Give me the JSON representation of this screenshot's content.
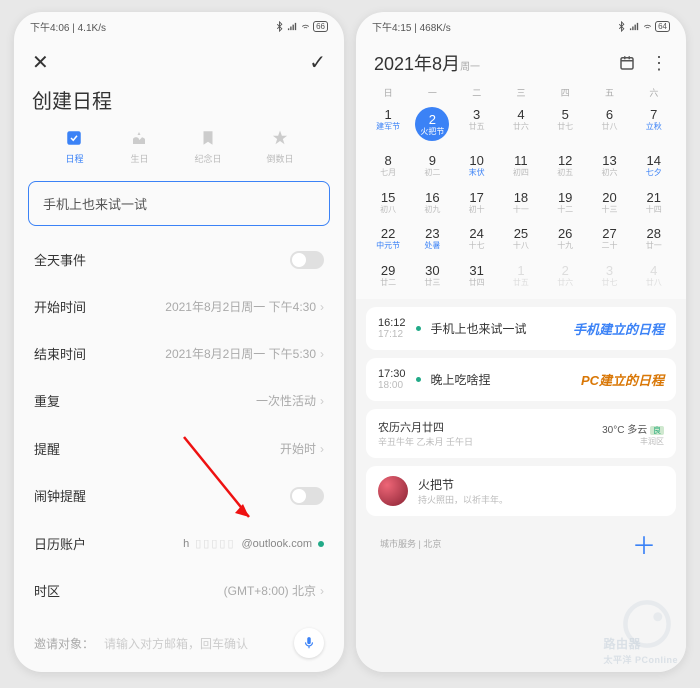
{
  "left": {
    "status": {
      "time": "下午4:06",
      "net": "4.1K/s",
      "battery": "66"
    },
    "title": "创建日程",
    "tabs": [
      {
        "label": "日程",
        "icon": "check-box"
      },
      {
        "label": "生日",
        "icon": "cake"
      },
      {
        "label": "纪念日",
        "icon": "bookmark"
      },
      {
        "label": "倒数日",
        "icon": "star"
      }
    ],
    "subject": "手机上也来试一试",
    "rows": {
      "allday": {
        "label": "全天事件"
      },
      "start": {
        "label": "开始时间",
        "value": "2021年8月2日周一 下午4:30"
      },
      "end": {
        "label": "结束时间",
        "value": "2021年8月2日周一 下午5:30"
      },
      "repeat": {
        "label": "重复",
        "value": "一次性活动"
      },
      "remind": {
        "label": "提醒",
        "value": "开始时"
      },
      "alarm": {
        "label": "闹钟提醒"
      },
      "account": {
        "label": "日历账户",
        "prefix": "h",
        "domain": "@outlook.com"
      },
      "tz": {
        "label": "时区",
        "value": "(GMT+8:00) 北京"
      }
    },
    "invite": {
      "label": "邀请对象：",
      "placeholder": "请输入对方邮箱，回车确认"
    }
  },
  "right": {
    "status": {
      "time": "下午4:15",
      "net": "468K/s",
      "battery": "64"
    },
    "month_title": "2021年8月",
    "month_sub": "周一",
    "dow": [
      "日",
      "一",
      "二",
      "三",
      "四",
      "五",
      "六"
    ],
    "days": [
      {
        "n": "1",
        "l": "建军节",
        "hol": true
      },
      {
        "n": "2",
        "l": "火把节",
        "sel": true
      },
      {
        "n": "3",
        "l": "廿五"
      },
      {
        "n": "4",
        "l": "廿六"
      },
      {
        "n": "5",
        "l": "廿七"
      },
      {
        "n": "6",
        "l": "廿八"
      },
      {
        "n": "7",
        "l": "立秋",
        "hol": true
      },
      {
        "n": "8",
        "l": "七月"
      },
      {
        "n": "9",
        "l": "初二"
      },
      {
        "n": "10",
        "l": "末伏",
        "hol": true
      },
      {
        "n": "11",
        "l": "初四"
      },
      {
        "n": "12",
        "l": "初五"
      },
      {
        "n": "13",
        "l": "初六"
      },
      {
        "n": "14",
        "l": "七夕",
        "hol": true
      },
      {
        "n": "15",
        "l": "初八"
      },
      {
        "n": "16",
        "l": "初九"
      },
      {
        "n": "17",
        "l": "初十"
      },
      {
        "n": "18",
        "l": "十一"
      },
      {
        "n": "19",
        "l": "十二"
      },
      {
        "n": "20",
        "l": "十三"
      },
      {
        "n": "21",
        "l": "十四"
      },
      {
        "n": "22",
        "l": "中元节",
        "hol": true
      },
      {
        "n": "23",
        "l": "处暑",
        "hol": true
      },
      {
        "n": "24",
        "l": "十七"
      },
      {
        "n": "25",
        "l": "十八"
      },
      {
        "n": "26",
        "l": "十九"
      },
      {
        "n": "27",
        "l": "二十"
      },
      {
        "n": "28",
        "l": "廿一"
      },
      {
        "n": "29",
        "l": "廿二"
      },
      {
        "n": "30",
        "l": "廿三"
      },
      {
        "n": "31",
        "l": "廿四"
      },
      {
        "n": "1",
        "l": "廿五",
        "dim": true
      },
      {
        "n": "2",
        "l": "廿六",
        "dim": true
      },
      {
        "n": "3",
        "l": "廿七",
        "dim": true
      },
      {
        "n": "4",
        "l": "廿八",
        "dim": true
      }
    ],
    "events": [
      {
        "t1": "16:12",
        "t2": "17:12",
        "title": "手机上也来试一试",
        "anno": "手机建立的日程",
        "anno_cls": "blue"
      },
      {
        "t1": "17:30",
        "t2": "18:00",
        "title": "晚上吃啥捏",
        "anno": "PC建立的日程",
        "anno_cls": "orange"
      }
    ],
    "weather": {
      "lunar": "农历六月廿四",
      "ganzhi": "辛丑牛年 乙未月 壬午日",
      "temp": "30°C 多云",
      "loc": "丰润区",
      "badge": "良"
    },
    "festival": {
      "name": "火把节",
      "desc": "持火照田，以祈丰年。"
    },
    "bottom": {
      "left": "城市服务",
      "city": "北京"
    },
    "watermark": {
      "brand": "路由器",
      "site": "太平洋 PConline"
    }
  }
}
